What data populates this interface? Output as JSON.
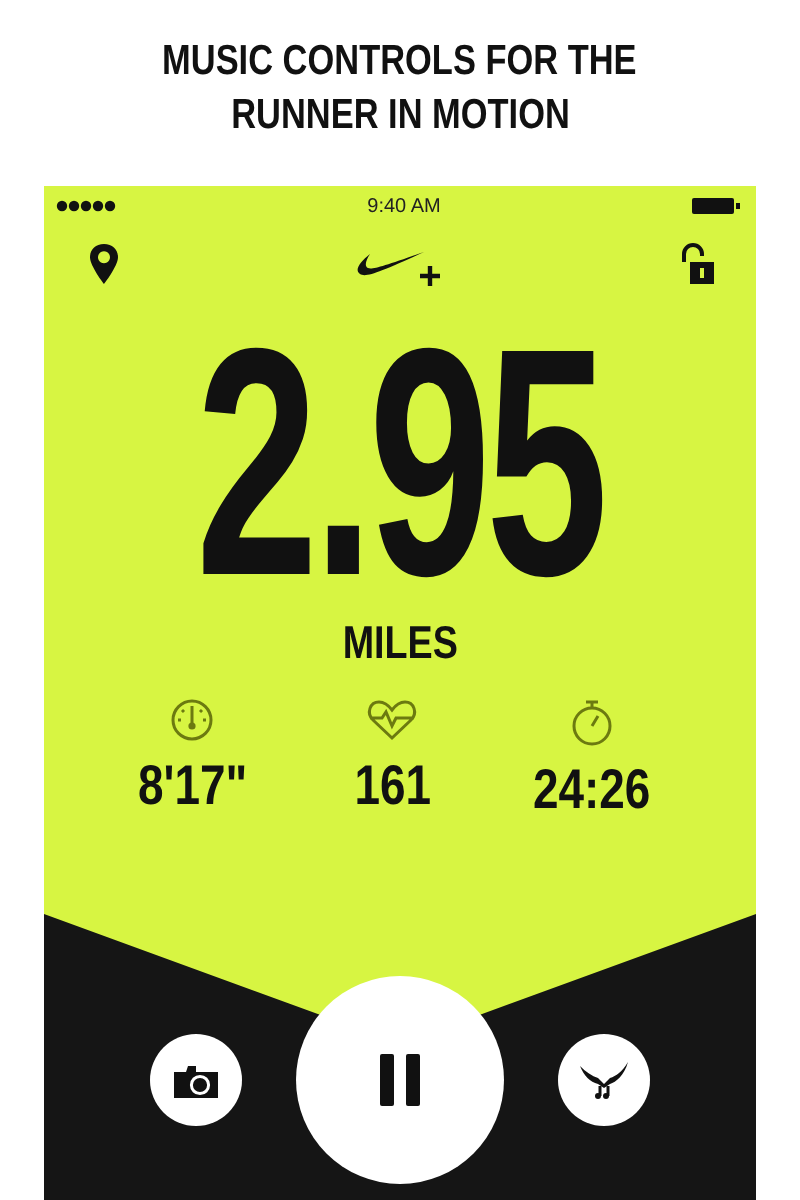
{
  "headline_lines": [
    "MUSIC CONTROLS FOR THE",
    "RUNNER IN MOTION"
  ],
  "status_bar": {
    "time": "9:40 AM"
  },
  "distance": {
    "value": "2.95",
    "unit": "MILES"
  },
  "stats": [
    {
      "kind": "pace",
      "value": "8'17\""
    },
    {
      "kind": "heart_rate",
      "value": "161"
    },
    {
      "kind": "duration",
      "value": "24:26"
    }
  ]
}
